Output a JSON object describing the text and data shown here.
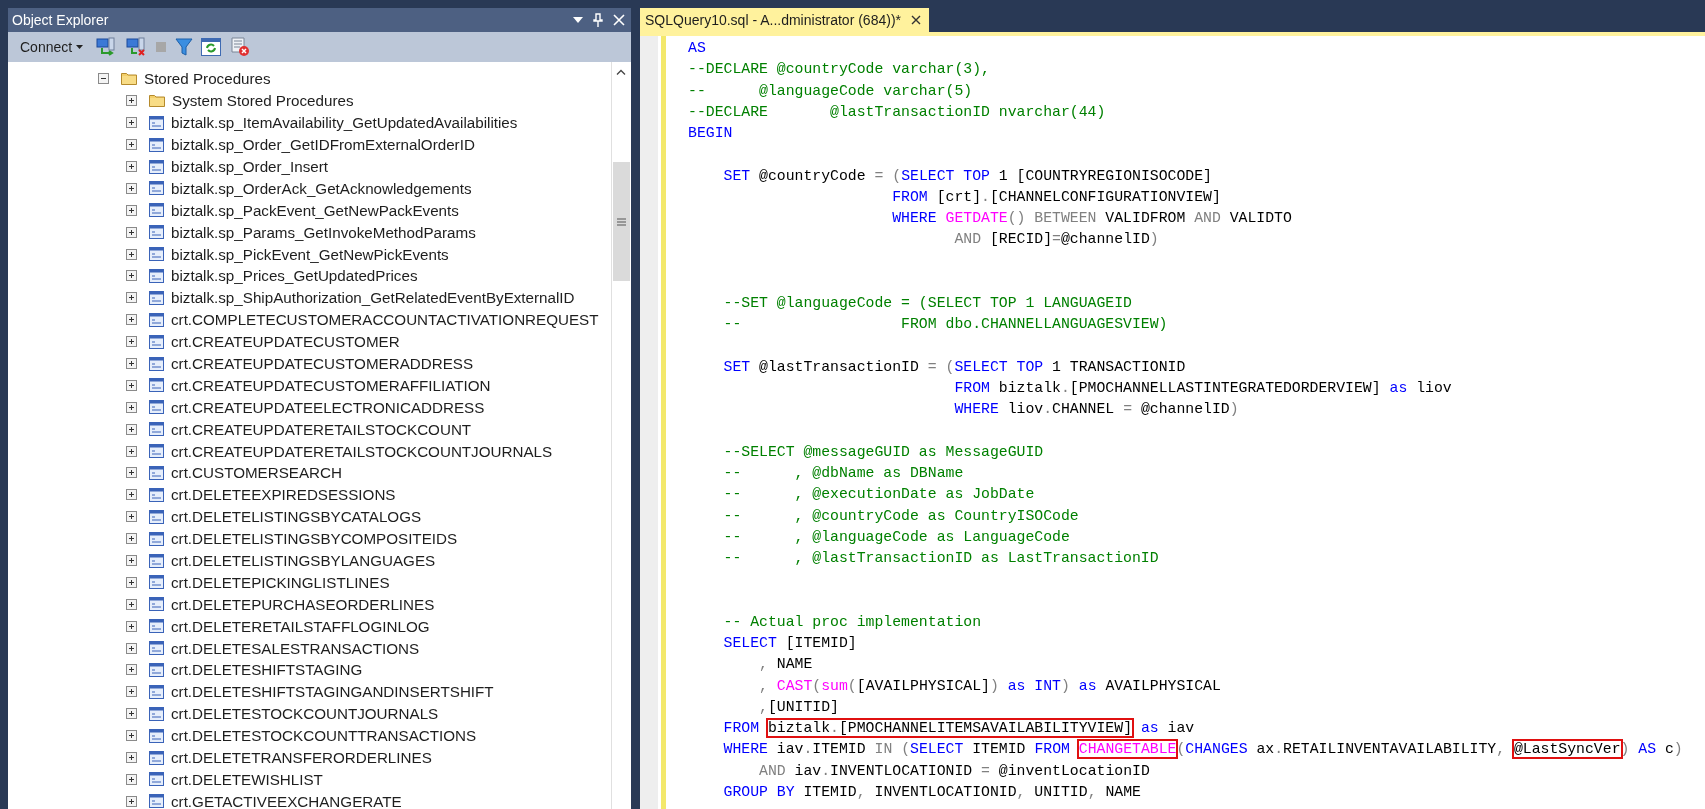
{
  "object_explorer": {
    "title": "Object Explorer",
    "toolbar": {
      "connect_label": "Connect"
    },
    "tree": [
      {
        "label": "Stored Procedures",
        "kind": "folder",
        "expanded": true,
        "children": [
          {
            "label": "System Stored Procedures",
            "kind": "folder",
            "expanded": false
          },
          {
            "label": "biztalk.sp_ItemAvailability_GetUpdatedAvailabilities",
            "kind": "procedure",
            "expanded": false
          },
          {
            "label": "biztalk.sp_Order_GetIDFromExternalOrderID",
            "kind": "procedure",
            "expanded": false
          },
          {
            "label": "biztalk.sp_Order_Insert",
            "kind": "procedure",
            "expanded": false
          },
          {
            "label": "biztalk.sp_OrderAck_GetAcknowledgements",
            "kind": "procedure",
            "expanded": false
          },
          {
            "label": "biztalk.sp_PackEvent_GetNewPackEvents",
            "kind": "procedure",
            "expanded": false
          },
          {
            "label": "biztalk.sp_Params_GetInvokeMethodParams",
            "kind": "procedure",
            "expanded": false
          },
          {
            "label": "biztalk.sp_PickEvent_GetNewPickEvents",
            "kind": "procedure",
            "expanded": false
          },
          {
            "label": "biztalk.sp_Prices_GetUpdatedPrices",
            "kind": "procedure",
            "expanded": false
          },
          {
            "label": "biztalk.sp_ShipAuthorization_GetRelatedEventByExternalID",
            "kind": "procedure",
            "expanded": false
          },
          {
            "label": "crt.COMPLETECUSTOMERACCOUNTACTIVATIONREQUEST",
            "kind": "procedure",
            "expanded": false
          },
          {
            "label": "crt.CREATEUPDATECUSTOMER",
            "kind": "procedure",
            "expanded": false
          },
          {
            "label": "crt.CREATEUPDATECUSTOMERADDRESS",
            "kind": "procedure",
            "expanded": false
          },
          {
            "label": "crt.CREATEUPDATECUSTOMERAFFILIATION",
            "kind": "procedure",
            "expanded": false
          },
          {
            "label": "crt.CREATEUPDATEELECTRONICADDRESS",
            "kind": "procedure",
            "expanded": false
          },
          {
            "label": "crt.CREATEUPDATERETAILSTOCKCOUNT",
            "kind": "procedure",
            "expanded": false
          },
          {
            "label": "crt.CREATEUPDATERETAILSTOCKCOUNTJOURNALS",
            "kind": "procedure",
            "expanded": false
          },
          {
            "label": "crt.CUSTOMERSEARCH",
            "kind": "procedure",
            "expanded": false
          },
          {
            "label": "crt.DELETEEXPIREDSESSIONS",
            "kind": "procedure",
            "expanded": false
          },
          {
            "label": "crt.DELETELISTINGSBYCATALOGS",
            "kind": "procedure",
            "expanded": false
          },
          {
            "label": "crt.DELETELISTINGSBYCOMPOSITEIDS",
            "kind": "procedure",
            "expanded": false
          },
          {
            "label": "crt.DELETELISTINGSBYLANGUAGES",
            "kind": "procedure",
            "expanded": false
          },
          {
            "label": "crt.DELETEPICKINGLISTLINES",
            "kind": "procedure",
            "expanded": false
          },
          {
            "label": "crt.DELETEPURCHASEORDERLINES",
            "kind": "procedure",
            "expanded": false
          },
          {
            "label": "crt.DELETERETAILSTAFFLOGINLOG",
            "kind": "procedure",
            "expanded": false
          },
          {
            "label": "crt.DELETESALESTRANSACTIONS",
            "kind": "procedure",
            "expanded": false
          },
          {
            "label": "crt.DELETESHIFTSTAGING",
            "kind": "procedure",
            "expanded": false
          },
          {
            "label": "crt.DELETESHIFTSTAGINGANDINSERTSHIFT",
            "kind": "procedure",
            "expanded": false
          },
          {
            "label": "crt.DELETESTOCKCOUNTJOURNALS",
            "kind": "procedure",
            "expanded": false
          },
          {
            "label": "crt.DELETESTOCKCOUNTTRANSACTIONS",
            "kind": "procedure",
            "expanded": false
          },
          {
            "label": "crt.DELETETRANSFERORDERLINES",
            "kind": "procedure",
            "expanded": false
          },
          {
            "label": "crt.DELETEWISHLIST",
            "kind": "procedure",
            "expanded": false
          },
          {
            "label": "crt.GETACTIVEEXCHANGERATE",
            "kind": "procedure",
            "expanded": false
          }
        ]
      }
    ]
  },
  "editor": {
    "tabs": [
      {
        "label": "SQLQuery10.sql - A...dministrator (684))*",
        "selected": true
      }
    ],
    "lines": [
      {
        "kind": "code",
        "segments": [
          {
            "text": "AS",
            "kind": "keyword"
          }
        ]
      },
      {
        "kind": "code",
        "segments": [
          {
            "text": "--DECLARE @countryCode varchar(3),",
            "kind": "comment"
          }
        ]
      },
      {
        "kind": "code",
        "segments": [
          {
            "text": "--      @languageCode varchar(5)",
            "kind": "comment"
          }
        ]
      },
      {
        "kind": "code",
        "segments": [
          {
            "text": "--DECLARE       @lastTransactionID nvarchar(44)",
            "kind": "comment"
          }
        ]
      },
      {
        "kind": "code",
        "segments": [
          {
            "text": "BEGIN",
            "kind": "keyword"
          }
        ]
      },
      {
        "kind": "blank"
      },
      {
        "kind": "code",
        "segments": [
          {
            "text": "    SET",
            "kind": "keyword"
          },
          {
            "text": " @countryCode ",
            "kind": "plain"
          },
          {
            "text": "= (",
            "kind": "operator"
          },
          {
            "text": "SELECT TOP",
            "kind": "keyword"
          },
          {
            "text": " 1 [COUNTRYREGIONISOCODE]",
            "kind": "plain"
          }
        ]
      },
      {
        "kind": "code",
        "segments": [
          {
            "text": "                       FROM",
            "kind": "keyword"
          },
          {
            "text": " [crt]",
            "kind": "plain"
          },
          {
            "text": ".",
            "kind": "operator"
          },
          {
            "text": "[CHANNELCONFIGURATIONVIEW]",
            "kind": "plain"
          }
        ]
      },
      {
        "kind": "code",
        "segments": [
          {
            "text": "                       WHERE",
            "kind": "keyword"
          },
          {
            "text": " GETDATE",
            "kind": "function"
          },
          {
            "text": "() BETWEEN",
            "kind": "operator"
          },
          {
            "text": " VALIDFROM ",
            "kind": "plain"
          },
          {
            "text": "AND",
            "kind": "operator"
          },
          {
            "text": " VALIDTO",
            "kind": "plain"
          }
        ]
      },
      {
        "kind": "code",
        "segments": [
          {
            "text": "                              AND",
            "kind": "operator"
          },
          {
            "text": " [RECID]",
            "kind": "plain"
          },
          {
            "text": "=",
            "kind": "operator"
          },
          {
            "text": "@channelID",
            "kind": "plain"
          },
          {
            "text": ")",
            "kind": "operator"
          }
        ]
      },
      {
        "kind": "blank"
      },
      {
        "kind": "blank"
      },
      {
        "kind": "code",
        "segments": [
          {
            "text": "    --SET @languageCode = (SELECT TOP 1 LANGUAGEID",
            "kind": "comment"
          }
        ]
      },
      {
        "kind": "code",
        "segments": [
          {
            "text": "    --                  FROM dbo.CHANNELLANGUAGESVIEW)",
            "kind": "comment"
          }
        ]
      },
      {
        "kind": "blank"
      },
      {
        "kind": "code",
        "segments": [
          {
            "text": "    SET",
            "kind": "keyword"
          },
          {
            "text": " @lastTransactionID ",
            "kind": "plain"
          },
          {
            "text": "= (",
            "kind": "operator"
          },
          {
            "text": "SELECT TOP",
            "kind": "keyword"
          },
          {
            "text": " 1 TRANSACTIONID",
            "kind": "plain"
          }
        ]
      },
      {
        "kind": "code",
        "segments": [
          {
            "text": "                              FROM",
            "kind": "keyword"
          },
          {
            "text": " biztalk",
            "kind": "plain"
          },
          {
            "text": ".",
            "kind": "operator"
          },
          {
            "text": "[PMOCHANNELLASTINTEGRATEDORDERVIEW] ",
            "kind": "plain"
          },
          {
            "text": "as",
            "kind": "keyword"
          },
          {
            "text": " liov",
            "kind": "plain"
          }
        ]
      },
      {
        "kind": "code",
        "segments": [
          {
            "text": "                              WHERE",
            "kind": "keyword"
          },
          {
            "text": " liov",
            "kind": "plain"
          },
          {
            "text": ".",
            "kind": "operator"
          },
          {
            "text": "CHANNEL ",
            "kind": "plain"
          },
          {
            "text": "=",
            "kind": "operator"
          },
          {
            "text": " @channelID",
            "kind": "plain"
          },
          {
            "text": ")",
            "kind": "operator"
          }
        ]
      },
      {
        "kind": "blank"
      },
      {
        "kind": "code",
        "segments": [
          {
            "text": "    --SELECT @messageGUID as MessageGUID",
            "kind": "comment"
          }
        ]
      },
      {
        "kind": "code",
        "segments": [
          {
            "text": "    --      , @dbName as DBName",
            "kind": "comment"
          }
        ]
      },
      {
        "kind": "code",
        "segments": [
          {
            "text": "    --      , @executionDate as JobDate",
            "kind": "comment"
          }
        ]
      },
      {
        "kind": "code",
        "segments": [
          {
            "text": "    --      , @countryCode as CountryISOCode",
            "kind": "comment"
          }
        ]
      },
      {
        "kind": "code",
        "segments": [
          {
            "text": "    --      , @languageCode as LanguageCode",
            "kind": "comment"
          }
        ]
      },
      {
        "kind": "code",
        "segments": [
          {
            "text": "    --      , @lastTransactionID as LastTransactionID",
            "kind": "comment"
          }
        ]
      },
      {
        "kind": "blank"
      },
      {
        "kind": "blank"
      },
      {
        "kind": "code",
        "segments": [
          {
            "text": "    -- Actual proc implementation",
            "kind": "comment"
          }
        ]
      },
      {
        "kind": "code",
        "segments": [
          {
            "text": "    SELECT",
            "kind": "keyword"
          },
          {
            "text": " [ITEMID]",
            "kind": "plain"
          }
        ]
      },
      {
        "kind": "code",
        "segments": [
          {
            "text": "        ,",
            "kind": "operator"
          },
          {
            "text": " NAME",
            "kind": "plain"
          }
        ]
      },
      {
        "kind": "code",
        "segments": [
          {
            "text": "        ,",
            "kind": "operator"
          },
          {
            "text": " CAST",
            "kind": "function"
          },
          {
            "text": "(",
            "kind": "operator"
          },
          {
            "text": "sum",
            "kind": "function"
          },
          {
            "text": "(",
            "kind": "operator"
          },
          {
            "text": "[AVAILPHYSICAL]",
            "kind": "plain"
          },
          {
            "text": ")",
            "kind": "operator"
          },
          {
            "text": " as INT",
            "kind": "keyword"
          },
          {
            "text": ")",
            "kind": "operator"
          },
          {
            "text": " as",
            "kind": "keyword"
          },
          {
            "text": " AVAILPHYSICAL",
            "kind": "plain"
          }
        ]
      },
      {
        "kind": "code",
        "segments": [
          {
            "text": "        ,",
            "kind": "operator"
          },
          {
            "text": "[UNITID]",
            "kind": "plain"
          }
        ]
      },
      {
        "kind": "code",
        "segments": [
          {
            "text": "    FROM",
            "kind": "keyword"
          },
          {
            "kind": "space"
          },
          {
            "kind": "marked",
            "parts": [
              {
                "text": "biztalk",
                "kind": "plain"
              },
              {
                "text": ".",
                "kind": "operator"
              },
              {
                "text": "[PMOCHANNELITEMSAVAILABILITYVIEW]",
                "kind": "plain"
              }
            ]
          },
          {
            "text": " as",
            "kind": "keyword"
          },
          {
            "text": " iav",
            "kind": "plain"
          }
        ]
      },
      {
        "kind": "code",
        "segments": [
          {
            "text": "    WHERE",
            "kind": "keyword"
          },
          {
            "text": " iav",
            "kind": "plain"
          },
          {
            "text": ".",
            "kind": "operator"
          },
          {
            "text": "ITEMID ",
            "kind": "plain"
          },
          {
            "text": "IN (",
            "kind": "operator"
          },
          {
            "text": "SELECT",
            "kind": "keyword"
          },
          {
            "text": " ITEMID ",
            "kind": "plain"
          },
          {
            "text": "FROM",
            "kind": "keyword"
          },
          {
            "kind": "space"
          },
          {
            "kind": "marked",
            "parts": [
              {
                "text": "CHANGETABLE",
                "kind": "function"
              }
            ]
          },
          {
            "text": "(",
            "kind": "operator"
          },
          {
            "text": "CHANGES",
            "kind": "keyword"
          },
          {
            "text": " ax",
            "kind": "plain"
          },
          {
            "text": ".",
            "kind": "operator"
          },
          {
            "text": "RETAILINVENTAVAILABILITY",
            "kind": "plain"
          },
          {
            "text": ",",
            "kind": "operator"
          },
          {
            "kind": "space"
          },
          {
            "kind": "marked",
            "parts": [
              {
                "text": "@LastSyncVer",
                "kind": "plain"
              }
            ]
          },
          {
            "text": ")",
            "kind": "operator"
          },
          {
            "text": " AS",
            "kind": "keyword"
          },
          {
            "text": " c",
            "kind": "plain"
          },
          {
            "text": ")",
            "kind": "operator"
          }
        ]
      },
      {
        "kind": "code",
        "segments": [
          {
            "text": "        AND",
            "kind": "operator"
          },
          {
            "text": " iav",
            "kind": "plain"
          },
          {
            "text": ".",
            "kind": "operator"
          },
          {
            "text": "INVENTLOCATIONID ",
            "kind": "plain"
          },
          {
            "text": "=",
            "kind": "operator"
          },
          {
            "text": " @inventLocationID",
            "kind": "plain"
          }
        ]
      },
      {
        "kind": "code",
        "segments": [
          {
            "text": "    GROUP BY",
            "kind": "keyword"
          },
          {
            "text": " ITEMID",
            "kind": "plain"
          },
          {
            "text": ",",
            "kind": "operator"
          },
          {
            "text": " INVENTLOCATIONID",
            "kind": "plain"
          },
          {
            "text": ",",
            "kind": "operator"
          },
          {
            "text": " UNITID",
            "kind": "plain"
          },
          {
            "text": ",",
            "kind": "operator"
          },
          {
            "text": " NAME",
            "kind": "plain"
          }
        ]
      }
    ]
  }
}
